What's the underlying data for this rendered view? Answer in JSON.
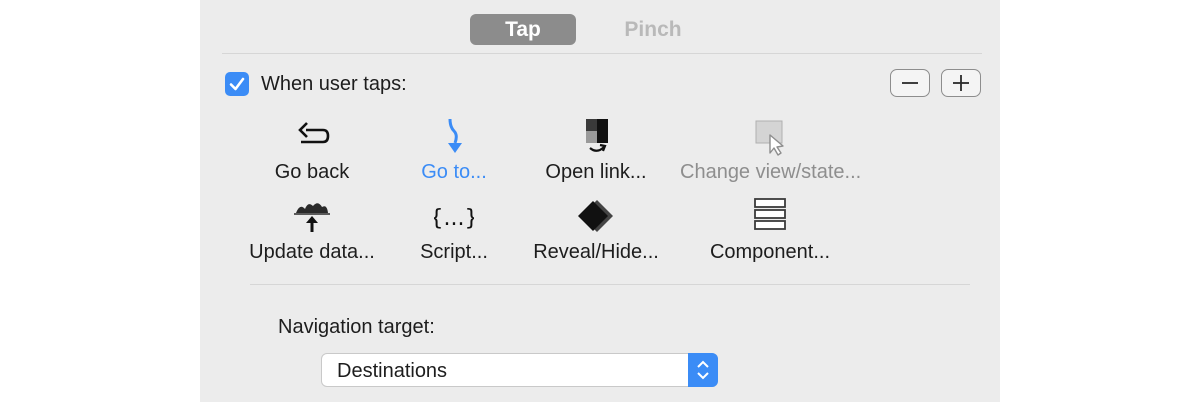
{
  "tabs": [
    {
      "label": "Tap",
      "active": true
    },
    {
      "label": "Pinch",
      "active": false
    }
  ],
  "trigger": {
    "label": "When user taps:",
    "checked": true
  },
  "toolbar": {
    "remove_icon": "minus-icon",
    "add_icon": "plus-icon"
  },
  "actions": [
    {
      "label": "Go back",
      "icon": "back-arrow-icon",
      "state": "normal"
    },
    {
      "label": "Go to...",
      "icon": "goto-arrow-icon",
      "state": "selected"
    },
    {
      "label": "Open link...",
      "icon": "open-link-icon",
      "state": "normal"
    },
    {
      "label": "Change view/state...",
      "icon": "change-view-icon",
      "state": "disabled"
    },
    {
      "label": "Update data...",
      "icon": "update-data-icon",
      "state": "normal"
    },
    {
      "label": "Script...",
      "icon": "script-braces-icon",
      "state": "normal"
    },
    {
      "label": "Reveal/Hide...",
      "icon": "reveal-hide-icon",
      "state": "normal"
    },
    {
      "label": "Component...",
      "icon": "component-stack-icon",
      "state": "normal"
    }
  ],
  "navigation": {
    "label": "Navigation target:",
    "value": "Destinations"
  },
  "colors": {
    "accent": "#3b8cf6",
    "panel": "#ececec",
    "disabled": "#8e8e8e"
  }
}
